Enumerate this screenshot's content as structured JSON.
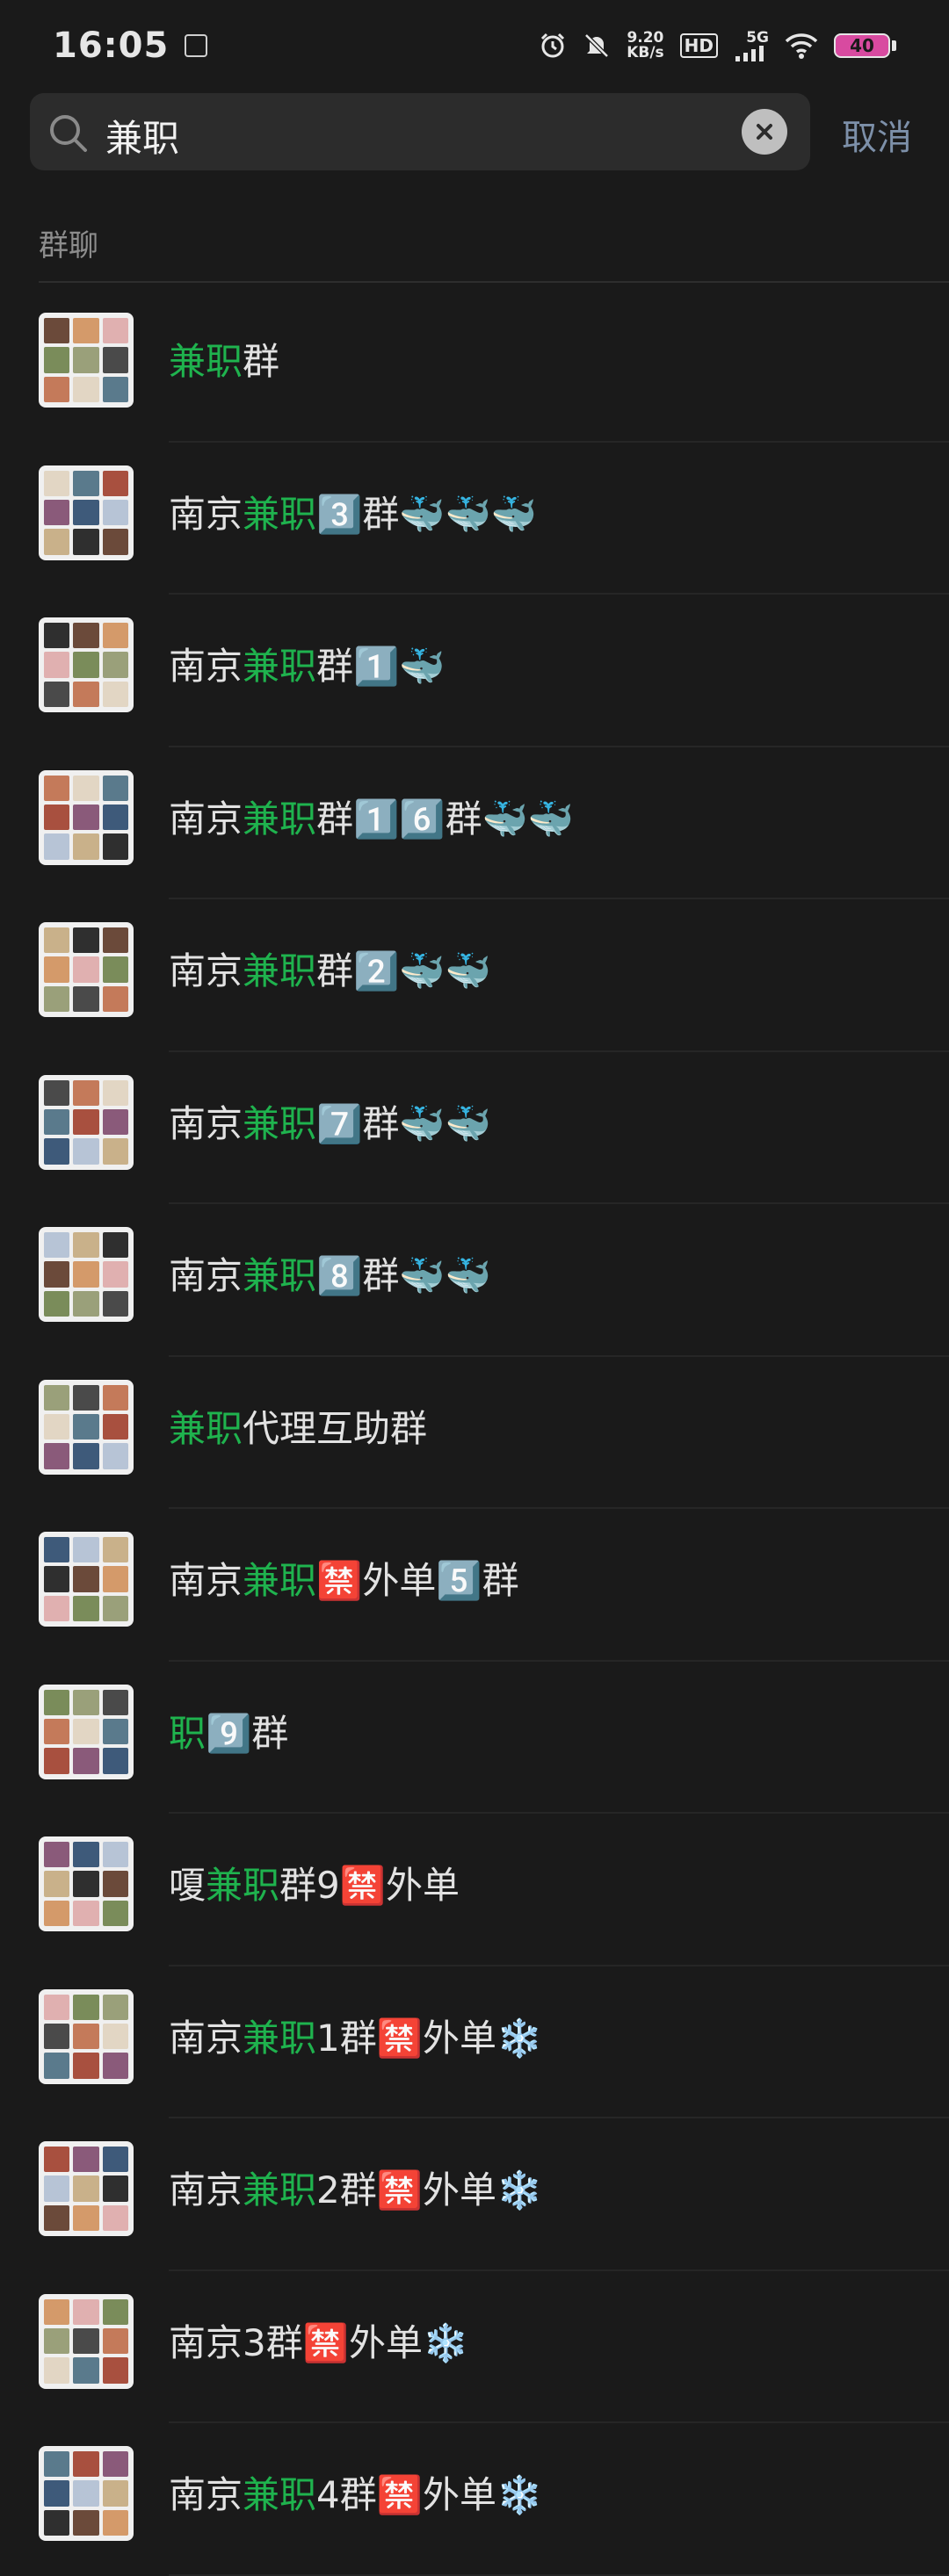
{
  "status_bar": {
    "time": "16:05",
    "net_speed_value": "9.20",
    "net_speed_unit": "KB/s",
    "hd_label": "HD",
    "network_label": "5G",
    "battery_level": "40",
    "icons": [
      "alarm-icon",
      "mute-icon",
      "signal-icon",
      "wifi-icon"
    ]
  },
  "search": {
    "value": "兼职",
    "cancel_label": "取消"
  },
  "section": {
    "label": "群聊"
  },
  "highlight_color": "#1fb34e",
  "results": [
    {
      "segments": [
        {
          "text": "兼职",
          "hl": true
        },
        {
          "text": "群",
          "hl": false
        }
      ]
    },
    {
      "segments": [
        {
          "text": "南京",
          "hl": false
        },
        {
          "text": "兼职",
          "hl": true
        },
        {
          "text": "3️⃣群🐳🐳🐳",
          "hl": false
        }
      ]
    },
    {
      "segments": [
        {
          "text": "南京",
          "hl": false
        },
        {
          "text": "兼职",
          "hl": true
        },
        {
          "text": "群1️⃣🐳",
          "hl": false
        }
      ]
    },
    {
      "segments": [
        {
          "text": "南京",
          "hl": false
        },
        {
          "text": "兼职",
          "hl": true
        },
        {
          "text": "群1️⃣6️⃣群🐳🐳",
          "hl": false
        }
      ]
    },
    {
      "segments": [
        {
          "text": "南京",
          "hl": false
        },
        {
          "text": "兼职",
          "hl": true
        },
        {
          "text": "群2️⃣🐳🐳",
          "hl": false
        }
      ]
    },
    {
      "segments": [
        {
          "text": "南京",
          "hl": false
        },
        {
          "text": "兼职",
          "hl": true
        },
        {
          "text": "7️⃣群🐳🐳",
          "hl": false
        }
      ]
    },
    {
      "segments": [
        {
          "text": "南京",
          "hl": false
        },
        {
          "text": "兼职",
          "hl": true
        },
        {
          "text": "8️⃣群🐳🐳",
          "hl": false
        }
      ]
    },
    {
      "segments": [
        {
          "text": "兼职",
          "hl": true
        },
        {
          "text": "代理互助群",
          "hl": false
        }
      ]
    },
    {
      "segments": [
        {
          "text": "南京",
          "hl": false
        },
        {
          "text": "兼职",
          "hl": true
        },
        {
          "text": "🈲外单5️⃣群",
          "hl": false
        }
      ]
    },
    {
      "segments": [
        {
          "text": "职",
          "hl": true
        },
        {
          "text": "9️⃣群",
          "hl": false
        }
      ]
    },
    {
      "segments": [
        {
          "text": "嗄",
          "hl": false
        },
        {
          "text": "兼职",
          "hl": true
        },
        {
          "text": "群9🈲外单",
          "hl": false
        }
      ]
    },
    {
      "segments": [
        {
          "text": "南京",
          "hl": false
        },
        {
          "text": "兼职",
          "hl": true
        },
        {
          "text": "1群🈲外单❄️",
          "hl": false
        }
      ]
    },
    {
      "segments": [
        {
          "text": "南京",
          "hl": false
        },
        {
          "text": "兼职",
          "hl": true
        },
        {
          "text": "2群🈲外单❄️",
          "hl": false
        }
      ]
    },
    {
      "segments": [
        {
          "text": "南京",
          "hl": false
        },
        {
          "text": "3群🈲外单❄️",
          "hl": false
        }
      ]
    },
    {
      "segments": [
        {
          "text": "南京",
          "hl": false
        },
        {
          "text": "兼职",
          "hl": true
        },
        {
          "text": "4群🈲外单❄️",
          "hl": false
        }
      ]
    }
  ]
}
